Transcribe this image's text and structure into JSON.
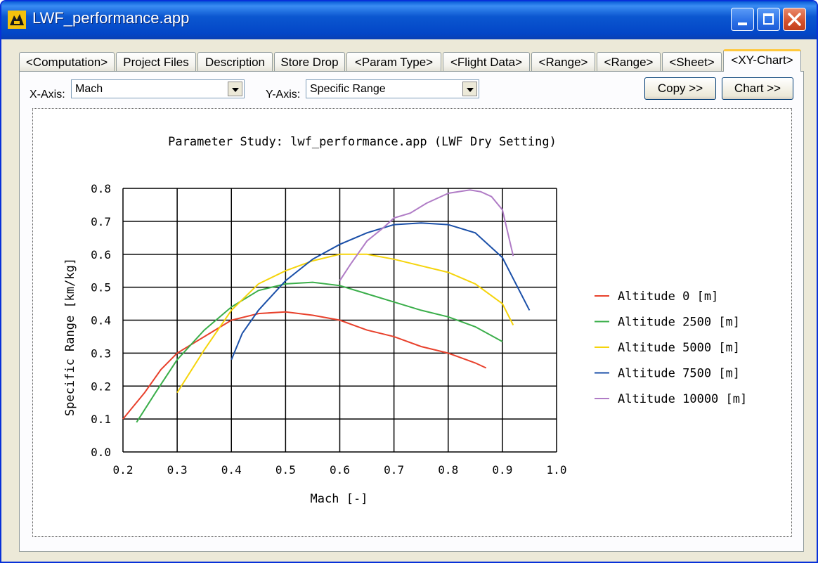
{
  "window": {
    "title": "LWF_performance.app"
  },
  "tabs": [
    {
      "label": "<Computation>"
    },
    {
      "label": "Project Files"
    },
    {
      "label": "Description"
    },
    {
      "label": "Store Drop"
    },
    {
      "label": "<Param Type>"
    },
    {
      "label": "<Flight Data>"
    },
    {
      "label": "<Range>"
    },
    {
      "label": "<Range>"
    },
    {
      "label": "<Sheet>"
    },
    {
      "label": "<XY-Chart>"
    }
  ],
  "toolbar": {
    "x_axis_label": "X-Axis:",
    "x_axis_value": "Mach",
    "y_axis_label": "Y-Axis:",
    "y_axis_value": "Specific Range",
    "copy_button": "Copy >>",
    "chart_button": "Chart >>"
  },
  "colors": {
    "title_bar": "#0346c7",
    "active_tab_accent": "#ffc83c"
  },
  "chart_data": {
    "type": "line",
    "title": "Parameter Study: lwf_performance.app (LWF Dry Setting)",
    "xlabel": "Mach [-]",
    "ylabel": "Specific Range [km/kg]",
    "xlim": [
      0.2,
      1.0
    ],
    "ylim": [
      0.0,
      0.8
    ],
    "x_ticks": [
      "0.2",
      "0.3",
      "0.4",
      "0.5",
      "0.6",
      "0.7",
      "0.8",
      "0.9",
      "1.0"
    ],
    "y_ticks": [
      "0.0",
      "0.1",
      "0.2",
      "0.3",
      "0.4",
      "0.5",
      "0.6",
      "0.7",
      "0.8"
    ],
    "grid": true,
    "legend_position": "right",
    "series": [
      {
        "name": "Altitude 0 [m]",
        "color": "#e8412c",
        "x": [
          0.2,
          0.24,
          0.27,
          0.3,
          0.34,
          0.37,
          0.4,
          0.45,
          0.5,
          0.55,
          0.6,
          0.65,
          0.7,
          0.75,
          0.8,
          0.85,
          0.87
        ],
        "y": [
          0.1,
          0.18,
          0.25,
          0.3,
          0.34,
          0.37,
          0.4,
          0.42,
          0.425,
          0.415,
          0.4,
          0.37,
          0.35,
          0.32,
          0.3,
          0.27,
          0.255
        ]
      },
      {
        "name": "Altitude 2500 [m]",
        "color": "#3aae4a",
        "x": [
          0.225,
          0.26,
          0.3,
          0.35,
          0.4,
          0.45,
          0.5,
          0.55,
          0.6,
          0.65,
          0.7,
          0.75,
          0.8,
          0.85,
          0.9
        ],
        "y": [
          0.09,
          0.18,
          0.28,
          0.37,
          0.44,
          0.49,
          0.51,
          0.515,
          0.505,
          0.48,
          0.455,
          0.43,
          0.41,
          0.38,
          0.335
        ]
      },
      {
        "name": "Altitude 5000 [m]",
        "color": "#f5d40c",
        "x": [
          0.3,
          0.35,
          0.4,
          0.45,
          0.5,
          0.55,
          0.6,
          0.65,
          0.7,
          0.75,
          0.8,
          0.85,
          0.9,
          0.92
        ],
        "y": [
          0.18,
          0.31,
          0.43,
          0.51,
          0.55,
          0.58,
          0.6,
          0.6,
          0.585,
          0.565,
          0.545,
          0.51,
          0.45,
          0.385
        ]
      },
      {
        "name": "Altitude 7500 [m]",
        "color": "#1a4fa8",
        "x": [
          0.4,
          0.42,
          0.45,
          0.5,
          0.55,
          0.6,
          0.65,
          0.7,
          0.75,
          0.8,
          0.85,
          0.9,
          0.95
        ],
        "y": [
          0.28,
          0.36,
          0.43,
          0.52,
          0.585,
          0.63,
          0.665,
          0.69,
          0.695,
          0.69,
          0.665,
          0.59,
          0.43
        ]
      },
      {
        "name": "Altitude 10000 [m]",
        "color": "#b07cc6",
        "x": [
          0.6,
          0.62,
          0.65,
          0.68,
          0.7,
          0.73,
          0.76,
          0.8,
          0.84,
          0.86,
          0.88,
          0.9,
          0.92
        ],
        "y": [
          0.52,
          0.57,
          0.64,
          0.68,
          0.71,
          0.725,
          0.755,
          0.785,
          0.795,
          0.79,
          0.775,
          0.735,
          0.595
        ]
      }
    ]
  }
}
